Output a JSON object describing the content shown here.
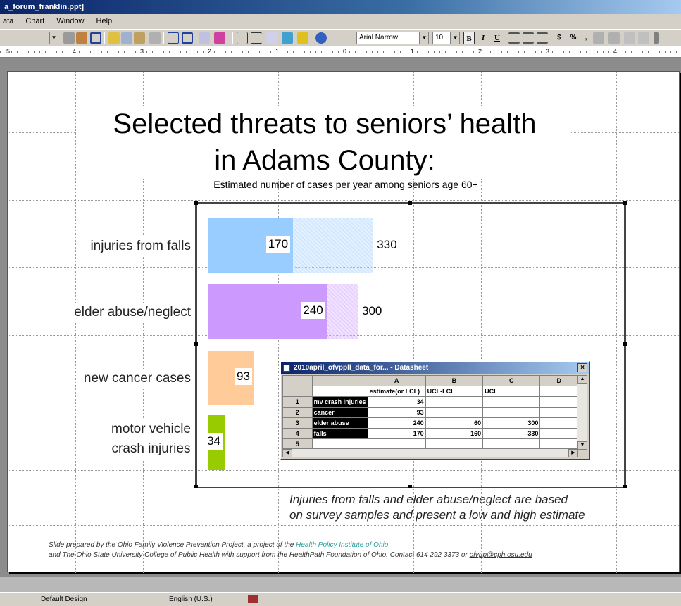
{
  "window": {
    "title": "a_forum_franklin.ppt]"
  },
  "menu": {
    "items": [
      "ata",
      "Chart",
      "Window",
      "Help"
    ]
  },
  "toolbar": {
    "font_name": "Arial Narrow",
    "font_size": "10",
    "bold": "B",
    "italic": "I",
    "underline": "U",
    "currency": "$",
    "percent": "%",
    "comma": ","
  },
  "ruler": {
    "labels": [
      "5",
      "4",
      "3",
      "2",
      "1",
      "0",
      "1",
      "2",
      "3",
      "4"
    ]
  },
  "slide": {
    "title_line1": "Selected threats to seniors’ health",
    "title_line2": "in Adams County:",
    "subtitle": "Estimated number of cases per year among seniors age 60+",
    "note_line1": "Injuries from falls and elder abuse/neglect are based",
    "note_line2": "on survey samples and present a low and high estimate",
    "credit_line1_a": "Slide prepared by the Ohio Family Violence Prevention Project, a project of the ",
    "credit_link": "Health Policy Institute of Ohio",
    "credit_line2_a": "and The Ohio State University College of Public Health with support from the HealthPath Foundation of Ohio.  Contact 614 292 3373 or ",
    "credit_email": "ofvpp@cph.osu.edu"
  },
  "chart_data": {
    "type": "bar",
    "orientation": "horizontal",
    "categories": [
      "injuries from falls",
      "elder abuse/neglect",
      "new cancer cases",
      "motor vehicle crash injuries"
    ],
    "category_lines": [
      [
        "injuries from falls"
      ],
      [
        "elder abuse/neglect"
      ],
      [
        "new cancer cases"
      ],
      [
        "motor vehicle",
        "crash injuries"
      ]
    ],
    "low_labels": [
      "170",
      "240",
      "93",
      "34"
    ],
    "high_labels": [
      "330",
      "300",
      "",
      ""
    ],
    "series": [
      {
        "values": [
          170,
          240,
          93,
          34
        ]
      },
      {
        "values": [
          330,
          300,
          null,
          null
        ]
      }
    ],
    "colors": [
      "#99ccff",
      "#cc99ff",
      "#ffcc99",
      "#99cc00"
    ],
    "xlim": [
      0,
      1000
    ],
    "grid": false
  },
  "datasheet": {
    "title": "2010april_ofvppll_data_for... - Datasheet",
    "close_label": "×",
    "columns": [
      "A",
      "B",
      "C",
      "D"
    ],
    "header_row": [
      "estimate(or LCL)",
      "UCL-LCL",
      "UCL",
      ""
    ],
    "rows": [
      {
        "num": "1",
        "label": "mv crash injuries",
        "a": "34",
        "b": "",
        "c": ""
      },
      {
        "num": "2",
        "label": "cancer",
        "a": "93",
        "b": "",
        "c": ""
      },
      {
        "num": "3",
        "label": "elder abuse",
        "a": "240",
        "b": "60",
        "c": "300"
      },
      {
        "num": "4",
        "label": "falls",
        "a": "170",
        "b": "160",
        "c": "330"
      },
      {
        "num": "5",
        "label": "",
        "a": "",
        "b": "",
        "c": ""
      }
    ]
  },
  "status": {
    "design": "Default Design",
    "language": "English (U.S.)"
  }
}
